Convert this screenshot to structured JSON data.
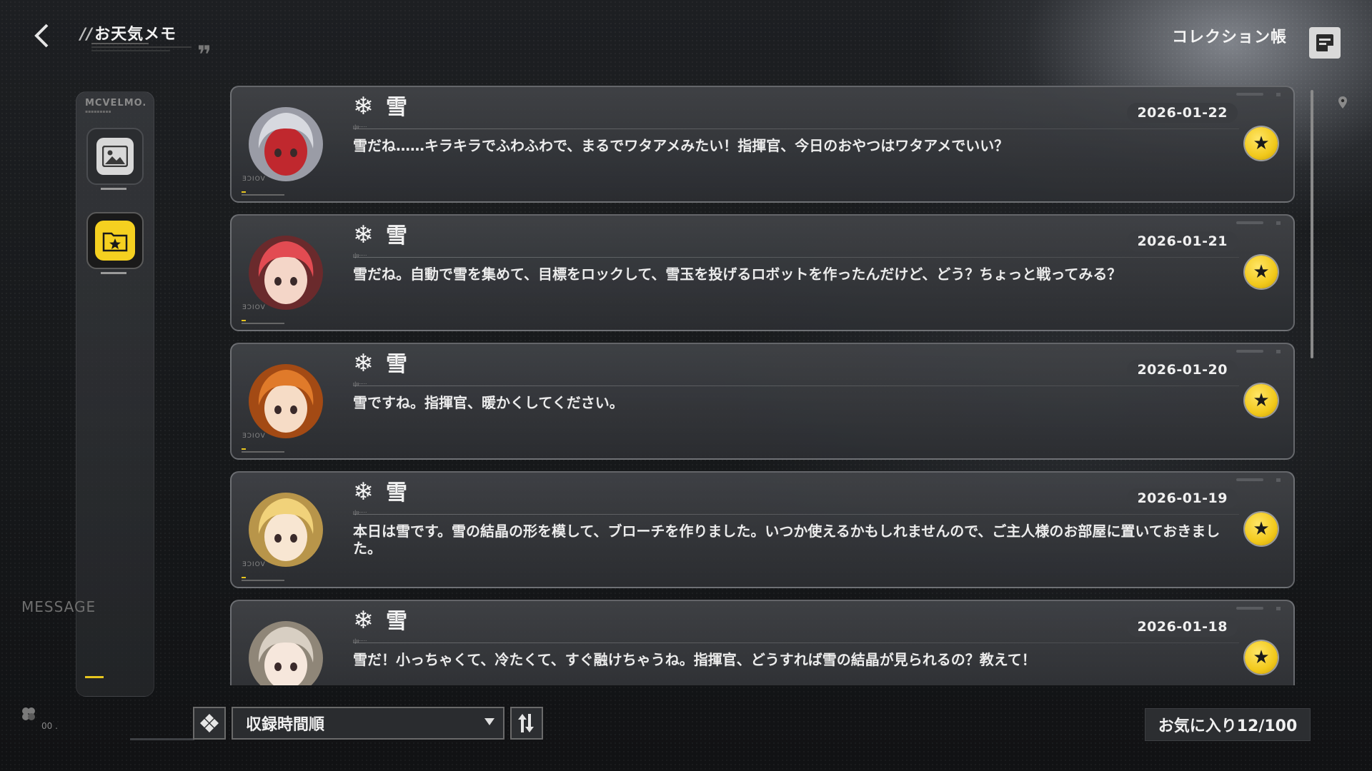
{
  "header": {
    "title": "お天気メモ",
    "collection_label": "コレクション帳"
  },
  "sidebar": {
    "brand": "MCVELMO.",
    "side_label": "MESSAGE"
  },
  "memos": [
    {
      "weather_icon": "❄",
      "weather": "雪",
      "date": "2026-01-22",
      "message": "雪だね……キラキラでふわふわで、まるでワタアメみたい！指揮官、今日のおやつはワタアメでいい？",
      "favorite": true
    },
    {
      "weather_icon": "❄",
      "weather": "雪",
      "date": "2026-01-21",
      "message": "雪だね。自動で雪を集めて、目標をロックして、雪玉を投げるロボットを作ったんだけど、どう？ちょっと戦ってみる？",
      "favorite": true
    },
    {
      "weather_icon": "❄",
      "weather": "雪",
      "date": "2026-01-20",
      "message": "雪ですね。指揮官、暖かくしてください。",
      "favorite": true
    },
    {
      "weather_icon": "❄",
      "weather": "雪",
      "date": "2026-01-19",
      "message": "本日は雪です。雪の結晶の形を模して、ブローチを作りました。いつか使えるかもしれませんので、ご主人様のお部屋に置いておきました。",
      "favorite": true
    },
    {
      "weather_icon": "❄",
      "weather": "雪",
      "date": "2026-01-18",
      "message": "雪だ！小っちゃくて、冷たくて、すぐ融けちゃうね。指揮官、どうすれば雪の結晶が見られるの？教えて！",
      "favorite": true
    }
  ],
  "voice_tag": "VOICE",
  "footer": {
    "sort_label": "収録時間順",
    "favorite_count": "お気に入り12/100",
    "small_text": "00 ."
  },
  "colors": {
    "accent_yellow": "#f2c91c",
    "card_border": "#aaacb2"
  },
  "icons": {
    "back": "chevron-left-icon",
    "collection": "notebook-icon",
    "gallery": "image-icon",
    "favorites": "star-folder-icon",
    "filter": "diamond-filter-icon",
    "order": "sort-order-icon",
    "favorite": "star-icon"
  }
}
